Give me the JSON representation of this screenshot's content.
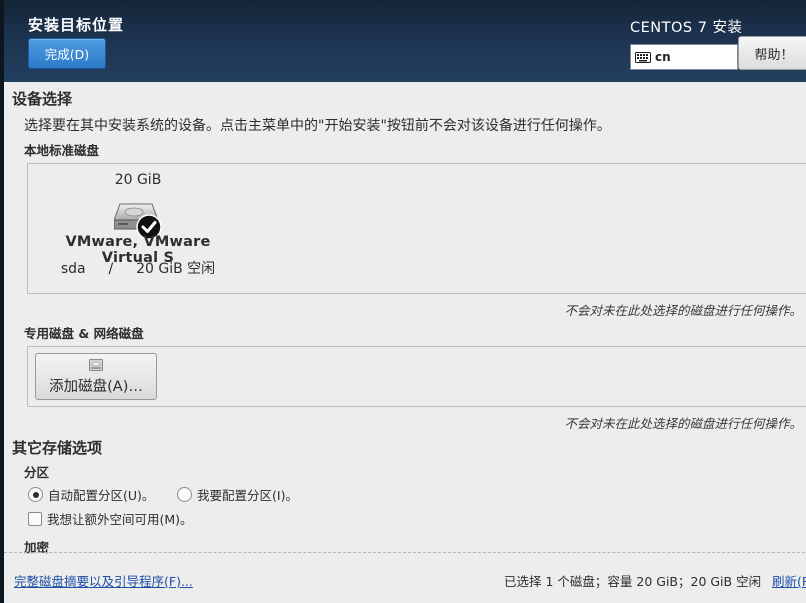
{
  "header": {
    "page_title": "安装目标位置",
    "done_label": "完成(D)",
    "product_title": "CENTOS 7 安装",
    "keyboard_layout": "cn",
    "help_label": "帮助！"
  },
  "device_selection": {
    "title": "设备选择",
    "description": "选择要在其中安装系统的设备。点击主菜单中的\"开始安装\"按钮前不会对该设备进行任何操作。",
    "local_disks": {
      "title": "本地标准磁盘",
      "disks": [
        {
          "size": "20 GiB",
          "name": "VMware, VMware Virtual S",
          "device": "sda",
          "separator": "/",
          "free": "20 GiB 空闲",
          "selected": true
        }
      ],
      "note": "不会对未在此处选择的磁盘进行任何操作。"
    },
    "special_disks": {
      "title": "专用磁盘 & 网络磁盘",
      "add_disk_label": "添加磁盘(A)…",
      "note": "不会对未在此处选择的磁盘进行任何操作。"
    }
  },
  "other_storage": {
    "title": "其它存储选项",
    "partitioning": {
      "title": "分区",
      "auto_label": "自动配置分区(U)。",
      "manual_label": "我要配置分区(I)。",
      "selected": "auto",
      "extra_space_label": "我想让额外空间可用(M)。",
      "extra_space_checked": false
    },
    "encryption": {
      "title": "加密"
    }
  },
  "footer": {
    "summary_link": "完整磁盘摘要以及引导程序(F)...",
    "status": "已选择 1 个磁盘；容量 20 GiB；20 GiB 空闲",
    "refresh_link": "刷新(R)"
  },
  "colors": {
    "header_bg": "#1c3350",
    "primary_button": "#2d7ac9",
    "link": "#1d4fa8",
    "background": "#ededed"
  }
}
